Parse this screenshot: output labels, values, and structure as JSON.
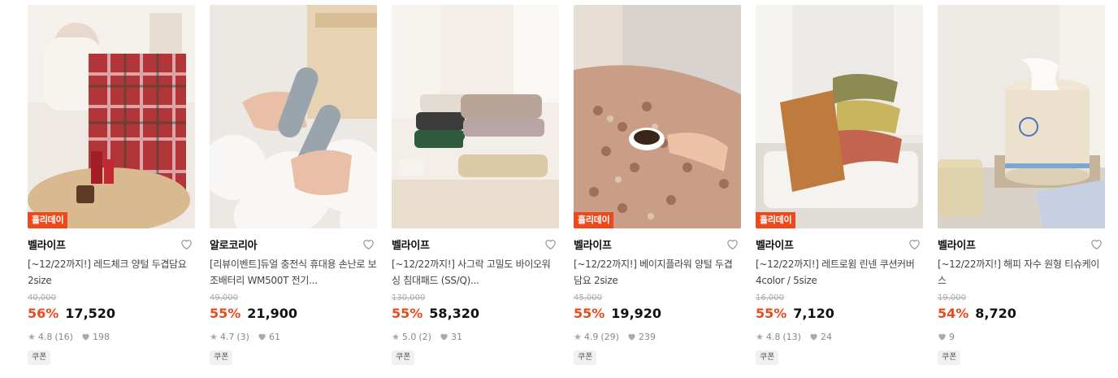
{
  "products": [
    {
      "badge": "홀리데이",
      "brand": "벨라이프",
      "title": "[~12/22까지!] 레드체크 양털 두겹담요 2size",
      "original_price": "40,000",
      "discount": "56%",
      "price": "17,520",
      "rating": "4.8",
      "reviews": "(16)",
      "likes": "198",
      "coupon": "쿠폰"
    },
    {
      "badge": "",
      "brand": "알로코리아",
      "title": "[리뷰이벤트]듀얼 충전식 휴대용 손난로 보조배터리 WM500T 전기...",
      "original_price": "49,000",
      "discount": "55%",
      "price": "21,900",
      "rating": "4.7",
      "reviews": "(3)",
      "likes": "61",
      "coupon": "쿠폰"
    },
    {
      "badge": "",
      "brand": "벨라이프",
      "title": "[~12/22까지!] 사그락 고밀도 바이오워싱 침대패드 (SS/Q)...",
      "original_price": "130,000",
      "discount": "55%",
      "price": "58,320",
      "rating": "5.0",
      "reviews": "(2)",
      "likes": "31",
      "coupon": "쿠폰"
    },
    {
      "badge": "홀리데이",
      "brand": "벨라이프",
      "title": "[~12/22까지!] 베이지플라워 양털 두겹담요 2size",
      "original_price": "45,000",
      "discount": "55%",
      "price": "19,920",
      "rating": "4.9",
      "reviews": "(29)",
      "likes": "239",
      "coupon": "쿠폰"
    },
    {
      "badge": "홀리데이",
      "brand": "벨라이프",
      "title": "[~12/22까지!] 레트로윔 린넨 쿠션커버 4color / 5size",
      "original_price": "16,000",
      "discount": "55%",
      "price": "7,120",
      "rating": "4.8",
      "reviews": "(13)",
      "likes": "24",
      "coupon": "쿠폰"
    },
    {
      "badge": "",
      "brand": "벨라이프",
      "title": "[~12/22까지!] 해피 자수 원형 티슈케이스",
      "original_price": "19,000",
      "discount": "54%",
      "price": "8,720",
      "rating": "",
      "reviews": "",
      "likes": "9",
      "coupon": "쿠폰"
    }
  ],
  "colors": {
    "accent": "#ec4a1c",
    "muted": "#888888"
  }
}
